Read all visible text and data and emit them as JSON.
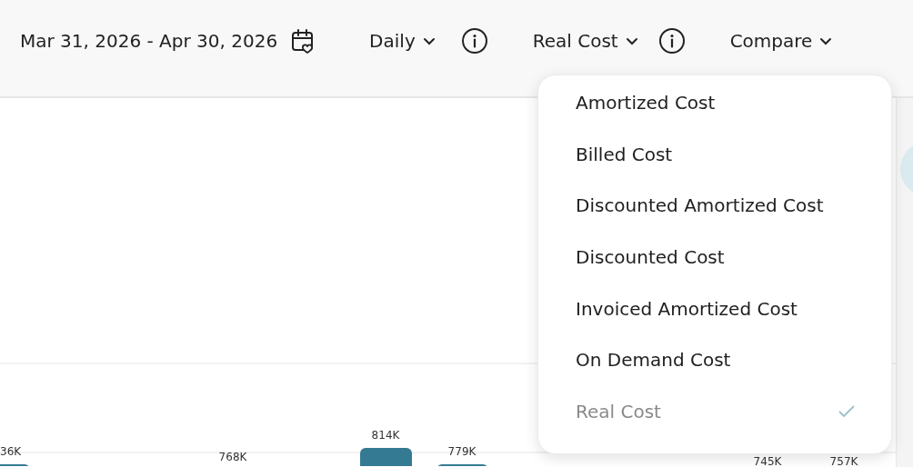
{
  "header": {
    "date_range": "Mar 31, 2026 - Apr 30, 2026",
    "granularity": {
      "label": "Daily"
    },
    "cost_type": {
      "label": "Real Cost",
      "expanded": true
    },
    "compare": {
      "label": "Compare"
    }
  },
  "cost_menu": [
    {
      "label": "Amortized Cost",
      "selected": false
    },
    {
      "label": "Billed Cost",
      "selected": false
    },
    {
      "label": "Discounted Amortized Cost",
      "selected": false
    },
    {
      "label": "Discounted Cost",
      "selected": false
    },
    {
      "label": "Invoiced Amortized Cost",
      "selected": false
    },
    {
      "label": "On Demand Cost",
      "selected": false
    },
    {
      "label": "Real Cost",
      "selected": true
    }
  ],
  "chart": {
    "value_labels": [
      "36K",
      "768K",
      "814K",
      "779K",
      "745K",
      "757K"
    ]
  }
}
